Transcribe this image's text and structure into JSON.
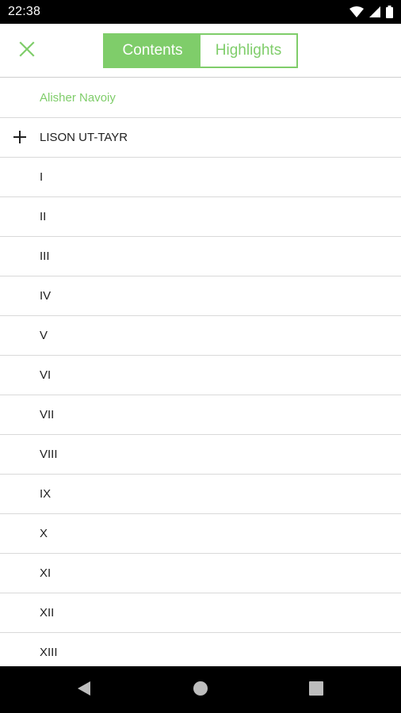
{
  "status_bar": {
    "time": "22:38",
    "icons": [
      "wifi-icon",
      "cell-signal-icon",
      "battery-icon"
    ]
  },
  "toolbar": {
    "close_icon": "close-icon",
    "tabs": [
      {
        "label": "Contents",
        "active": true
      },
      {
        "label": "Highlights",
        "active": false
      }
    ]
  },
  "toc": {
    "author": "Alisher Navoiy",
    "book": {
      "title": "LISON UT-TAYR",
      "expand_icon": "plus-icon"
    },
    "chapters": [
      "I",
      "II",
      "III",
      "IV",
      "V",
      "VI",
      "VII",
      "VIII",
      "IX",
      "X",
      "XI",
      "XII",
      "XIII"
    ]
  },
  "nav_bar": {
    "buttons": [
      "back-icon",
      "home-icon",
      "recents-icon"
    ]
  },
  "colors": {
    "accent": "#7fcd6a",
    "status_bar": "#000000",
    "divider": "#d9d9d9",
    "text": "#212121"
  }
}
